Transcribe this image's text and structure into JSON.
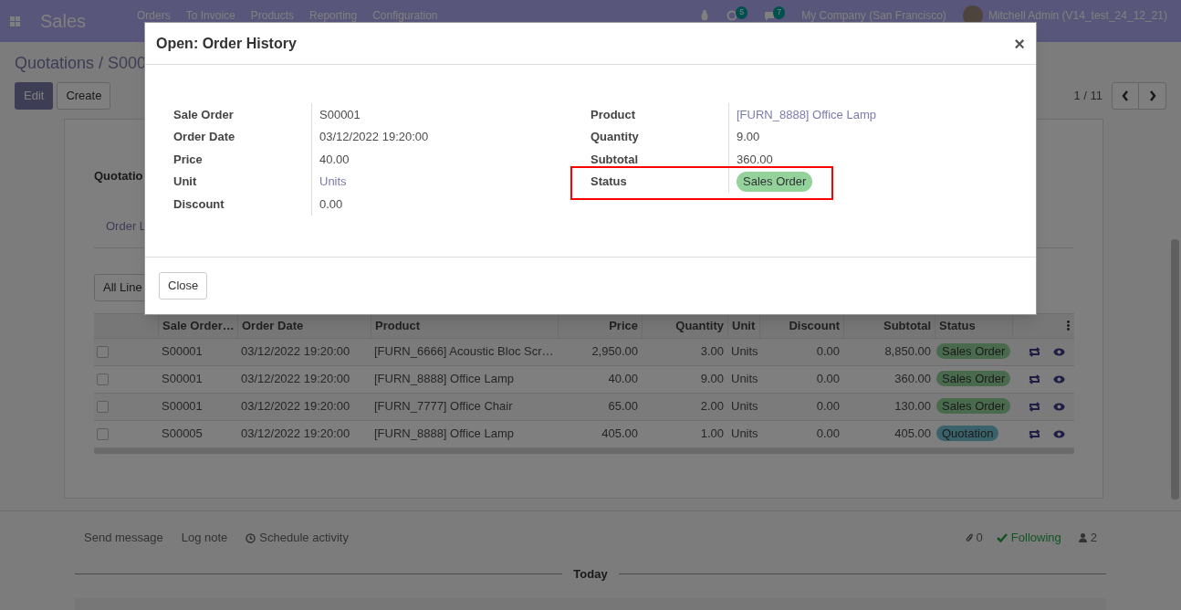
{
  "navbar": {
    "app_title": "Sales",
    "menu": [
      "Orders",
      "To Invoice",
      "Products",
      "Reporting",
      "Configuration"
    ],
    "activity_count": "5",
    "message_count": "7",
    "company": "My Company (San Francisco)",
    "user": "Mitchell Admin (V14_test_24_12_21)"
  },
  "breadcrumb": "Quotations / S000",
  "buttons": {
    "edit": "Edit",
    "create": "Create"
  },
  "pager": "1 / 11",
  "form": {
    "section_label": "Quotatio",
    "tab": "Order L",
    "filter": "All Line"
  },
  "table": {
    "columns": [
      "Sale Order…",
      "Order Date",
      "Product",
      "Price",
      "Quantity",
      "Unit",
      "Discount",
      "Subtotal",
      "Status"
    ],
    "rows": [
      {
        "checked": false,
        "cells": [
          "S00001",
          "03/12/2022 19:20:00",
          "[FURN_6666] Acoustic Bloc Scr…",
          "2,950.00",
          "3.00",
          "Units",
          "0.00",
          "8,850.00"
        ],
        "status": "Sales Order",
        "color": "#4a6a4e"
      },
      {
        "checked": false,
        "cells": [
          "S00001",
          "03/12/2022 19:20:00",
          "[FURN_8888] Office Lamp",
          "40.00",
          "9.00",
          "Units",
          "0.00",
          "360.00"
        ],
        "status": "Sales Order",
        "color": "#4a6a4e"
      },
      {
        "checked": false,
        "cells": [
          "S00001",
          "03/12/2022 19:20:00",
          "[FURN_7777] Office Chair",
          "65.00",
          "2.00",
          "Units",
          "0.00",
          "130.00"
        ],
        "status": "Sales Order",
        "color": "#4a6a4e"
      },
      {
        "checked": false,
        "cells": [
          "S00005",
          "03/12/2022 19:20:00",
          "[FURN_8888] Office Lamp",
          "405.00",
          "1.00",
          "Units",
          "0.00",
          "405.00"
        ],
        "status": "Quotation",
        "color": "#3a626b"
      }
    ]
  },
  "chatter": {
    "send_message": "Send message",
    "log_note": "Log note",
    "schedule_activity": "Schedule activity",
    "attachments": "0",
    "following": "Following",
    "followers": "2",
    "date_separator": "Today"
  },
  "dialog": {
    "title": "Open: Order History",
    "close_icon": "×",
    "left_fields": [
      {
        "label": "Sale Order",
        "value": "S00001",
        "kind": "text"
      },
      {
        "label": "Order Date",
        "value": "03/12/2022 19:20:00",
        "kind": "text"
      },
      {
        "label": "Price",
        "value": "40.00",
        "kind": "text"
      },
      {
        "label": "Unit",
        "value": "Units",
        "kind": "link"
      },
      {
        "label": "Discount",
        "value": "0.00",
        "kind": "text"
      }
    ],
    "right_fields": [
      {
        "label": "Product",
        "value": "[FURN_8888] Office Lamp",
        "kind": "link",
        "highlighted": false
      },
      {
        "label": "Quantity",
        "value": "9.00",
        "kind": "text",
        "highlighted": false
      },
      {
        "label": "Subtotal",
        "value": "360.00",
        "kind": "text",
        "highlighted": false
      },
      {
        "label": "Status",
        "value": "Sales Order",
        "kind": "badge",
        "color": "#93d39b",
        "highlighted": true
      }
    ],
    "close_button": "Close"
  }
}
